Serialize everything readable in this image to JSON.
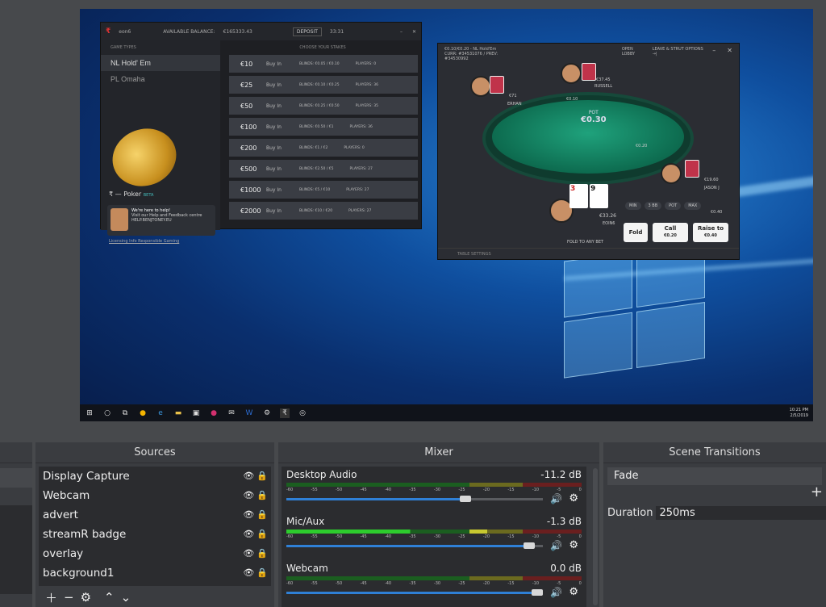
{
  "lobby": {
    "user": "eon6",
    "balance_label": "AVAILABLE BALANCE:",
    "balance": "€165333.43",
    "deposit": "DEPOSIT",
    "time": "33:31",
    "game_types_head": "GAME TYPES",
    "stakes_head": "CHOOSE YOUR STAKES",
    "categories": [
      "NL Hold' Em",
      "PL Omaha"
    ],
    "poker_logo": "Poker",
    "beta": "BETA",
    "help_title": "We're here to help!",
    "help_text": "Visit our Help and Feedback centre HELP.BENJTONEY.EU",
    "links": "Licensing Info  Responsible Gaming",
    "stakes": [
      {
        "amount": "€10",
        "buyin": "Buy In",
        "blinds": "BLINDS: €0.05 / €0.10",
        "players": "PLAYERS: 0"
      },
      {
        "amount": "€25",
        "buyin": "Buy In",
        "blinds": "BLINDS: €0.10 / €0.25",
        "players": "PLAYERS: 36"
      },
      {
        "amount": "€50",
        "buyin": "Buy In",
        "blinds": "BLINDS: €0.25 / €0.50",
        "players": "PLAYERS: 35"
      },
      {
        "amount": "€100",
        "buyin": "Buy In",
        "blinds": "BLINDS: €0.50 / €1",
        "players": "PLAYERS: 36"
      },
      {
        "amount": "€200",
        "buyin": "Buy In",
        "blinds": "BLINDS: €1 / €2",
        "players": "PLAYERS: 0"
      },
      {
        "amount": "€500",
        "buyin": "Buy In",
        "blinds": "BLINDS: €2.50 / €5",
        "players": "PLAYERS: 27"
      },
      {
        "amount": "€1000",
        "buyin": "Buy In",
        "blinds": "BLINDS: €5 / €10",
        "players": "PLAYERS: 27"
      },
      {
        "amount": "€2000",
        "buyin": "Buy In",
        "blinds": "BLINDS: €10 / €20",
        "players": "PLAYERS: 27"
      }
    ]
  },
  "table": {
    "title": "€0.10/€0.20 - NL Hold'Em",
    "sub": "CURR: #34531076  /  PREV: #34530992",
    "open_lobby": "OPEN LOBBY",
    "leave": "LEAVE & STRUT OPTIONS →|",
    "pot_label": "POT",
    "pot": "€0.30",
    "players": [
      {
        "name": "ERHAN",
        "stack": "€71"
      },
      {
        "name": "RUSSELL",
        "stack": "€37.45"
      },
      {
        "name": "JASON J",
        "stack": "€19.60"
      },
      {
        "name": "EOIN6",
        "stack": "€33.26"
      }
    ],
    "bet_top": "€0.10",
    "bet_right": "€0.20",
    "hero_cards": [
      "3",
      "9"
    ],
    "small_btns": [
      "MIN",
      "3 BB",
      "POT",
      "MAX"
    ],
    "raise_amt": "€0.40",
    "fold": "Fold",
    "call": "Call",
    "call_amt": "€0.20",
    "raise": "Raise to",
    "raise_to_amt": "€0.40",
    "fold_any": "FOLD TO ANY BET",
    "settings": "TABLE SETTINGS"
  },
  "taskbar": {
    "time": "10:21 PM",
    "date": "2/5/2019"
  },
  "sources": {
    "title": "Sources",
    "items": [
      "Display Capture",
      "Webcam",
      "advert",
      "streamR badge",
      "overlay",
      "background1"
    ]
  },
  "mixer": {
    "title": "Mixer",
    "ticks": [
      "-60",
      "-55",
      "-50",
      "-45",
      "-40",
      "-35",
      "-30",
      "-25",
      "-20",
      "-15",
      "-10",
      "-5",
      "0"
    ],
    "channels": [
      {
        "name": "Desktop Audio",
        "db": "-11.2 dB",
        "level": 0.72
      },
      {
        "name": "Mic/Aux",
        "db": "-1.3 dB",
        "level": 0.97
      },
      {
        "name": "Webcam",
        "db": "0.0 dB",
        "level": 1.0
      }
    ]
  },
  "transitions": {
    "title": "Scene Transitions",
    "selected": "Fade",
    "duration_label": "Duration",
    "duration": "250ms"
  }
}
